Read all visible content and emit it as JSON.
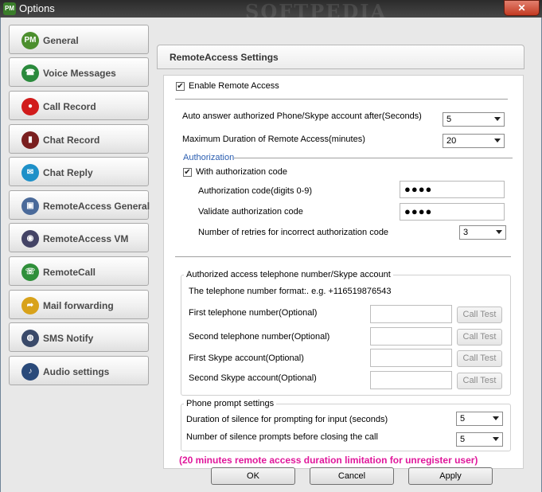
{
  "window": {
    "title": "Options",
    "watermark": "SOFTPEDIA",
    "close_glyph": "✕"
  },
  "sidebar": {
    "items": [
      {
        "label": "General",
        "icon": "pm-icon",
        "glyph": "PM",
        "color": "#4c8f2e"
      },
      {
        "label": "Voice Messages",
        "icon": "voice-message-icon",
        "glyph": "☎",
        "color": "#2a8a3c"
      },
      {
        "label": "Call Record",
        "icon": "record-icon",
        "glyph": "●",
        "color": "#d11b1b"
      },
      {
        "label": "Chat Record",
        "icon": "chat-record-icon",
        "glyph": "▮",
        "color": "#7a1f1f"
      },
      {
        "label": "Chat Reply",
        "icon": "chat-reply-icon",
        "glyph": "✉",
        "color": "#1e90c8"
      },
      {
        "label": "RemoteAccess General",
        "icon": "remote-access-icon",
        "glyph": "▣",
        "color": "#4a6a9a"
      },
      {
        "label": "RemoteAccess VM",
        "icon": "remote-vm-icon",
        "glyph": "◉",
        "color": "#444466"
      },
      {
        "label": "RemoteCall",
        "icon": "remote-call-icon",
        "glyph": "☏",
        "color": "#2f8f3a"
      },
      {
        "label": "Mail forwarding",
        "icon": "mail-forward-icon",
        "glyph": "➦",
        "color": "#d8a21a"
      },
      {
        "label": "SMS Notify",
        "icon": "sms-icon",
        "glyph": "◍",
        "color": "#3a4a6a"
      },
      {
        "label": "Audio settings",
        "icon": "audio-icon",
        "glyph": "♪",
        "color": "#2a4a7a"
      }
    ]
  },
  "panel": {
    "title": "RemoteAccess Settings",
    "enable_remote_access": {
      "label": "Enable Remote Access",
      "checked": true
    },
    "auto_answer": {
      "label": "Auto answer authorized Phone/Skype account after(Seconds)",
      "value": "5"
    },
    "max_duration": {
      "label": "Maximum Duration of Remote Access(minutes)",
      "value": "20"
    },
    "authorization": {
      "section_label": "Authorization",
      "with_code": {
        "label": "With authorization code",
        "checked": true
      },
      "code": {
        "label": "Authorization code(digits 0-9)",
        "value": "●●●●"
      },
      "validate": {
        "label": "Validate authorization code",
        "value": "●●●●"
      },
      "retries": {
        "label": "Number of retries for incorrect authorization code",
        "value": "3"
      }
    },
    "authorized_numbers": {
      "title": "Authorized access telephone number/Skype account",
      "format": "The telephone number format:. e.g.  +116519876543",
      "rows": [
        {
          "label": "First telephone number(Optional)",
          "button": "Call Test"
        },
        {
          "label": "Second telephone number(Optional)",
          "button": "Call Test"
        },
        {
          "label": "First Skype account(Optional)",
          "button": "Call Test"
        },
        {
          "label": "Second Skype account(Optional)",
          "button": "Call Test"
        }
      ]
    },
    "prompt": {
      "title": "Phone prompt settings",
      "silence_duration": {
        "label": "Duration of silence for prompting for input (seconds)",
        "value": "5"
      },
      "silence_count": {
        "label": "Number of silence prompts before closing the call",
        "value": "5"
      }
    },
    "limitation_note": "(20 minutes remote access duration limitation for unregister user)",
    "note_color": "#e0179b",
    "accent_color": "#2a5db0"
  },
  "footer": {
    "ok": "OK",
    "cancel": "Cancel",
    "apply": "Apply"
  }
}
